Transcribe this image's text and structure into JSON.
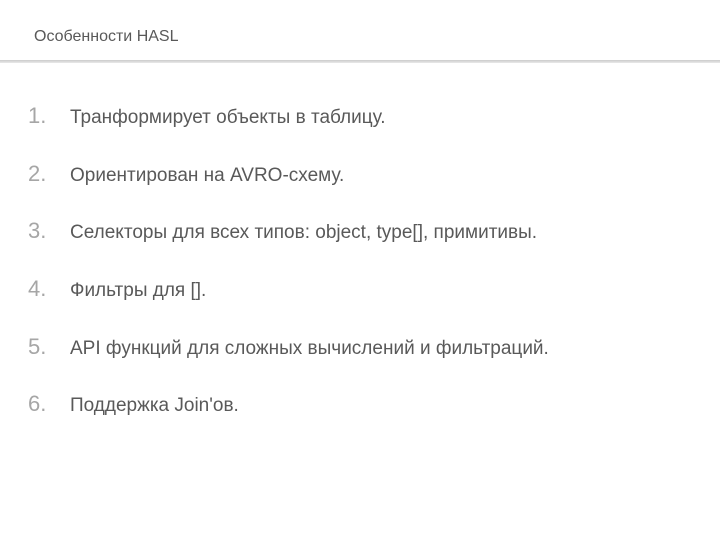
{
  "header": {
    "title": "Особенности HASL"
  },
  "list": {
    "items": [
      {
        "num": "1.",
        "text": "Транформирует объекты в таблицу."
      },
      {
        "num": "2.",
        "text": "Ориентирован на AVRO-схему."
      },
      {
        "num": "3.",
        "text": "Селекторы для всех типов: object, type[], примитивы."
      },
      {
        "num": "4.",
        "text": "Фильтры для []."
      },
      {
        "num": "5.",
        "text": "API функций для сложных вычислений и фильтраций."
      },
      {
        "num": "6.",
        "text": "Поддержка Join'ов."
      }
    ]
  }
}
